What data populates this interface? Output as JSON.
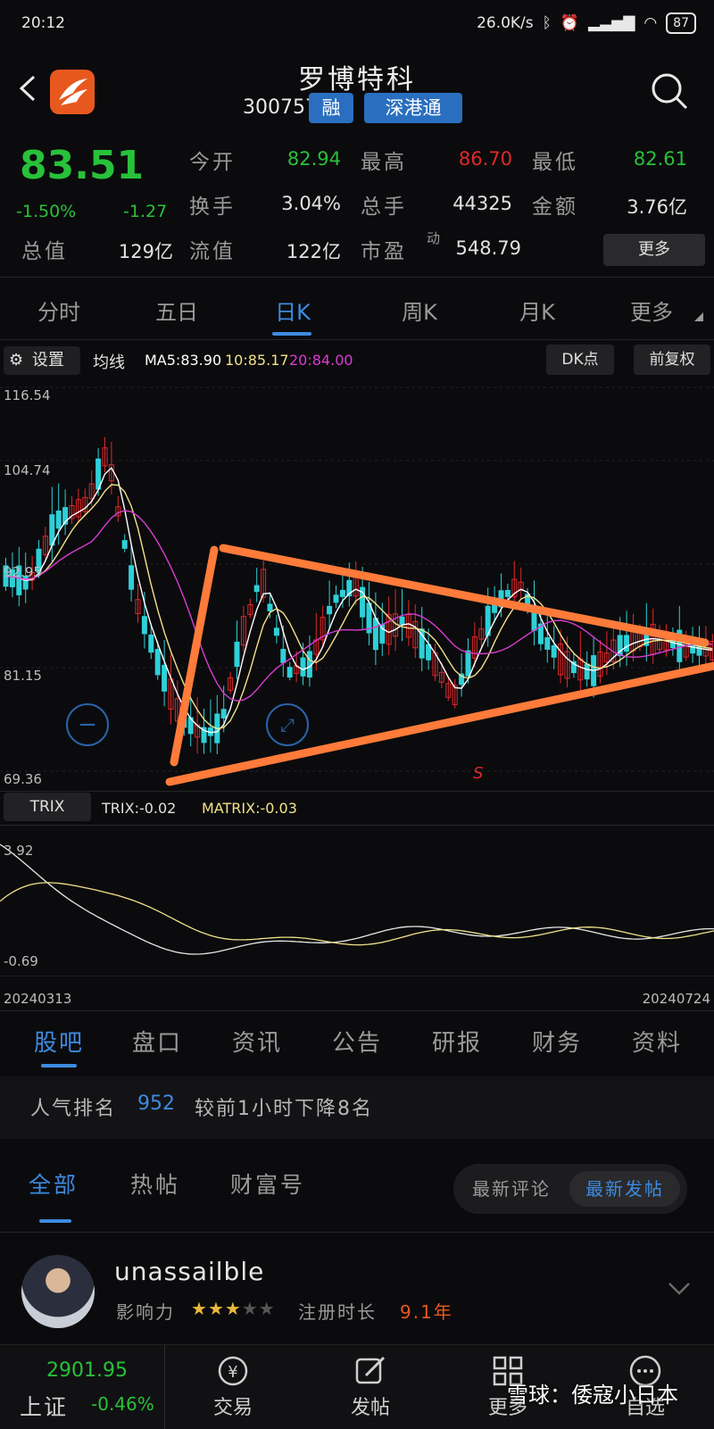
{
  "status": {
    "time": "20:12",
    "net_speed": "26.0K/s",
    "battery": "87"
  },
  "header": {
    "title": "罗博特科",
    "code": "300757",
    "tag_margin": "融",
    "tag_connect": "深港通"
  },
  "quote": {
    "price": "83.51",
    "change_pct": "-1.50%",
    "change": "-1.27",
    "items": [
      {
        "label": "今开",
        "value": "82.94",
        "color": "#28c13a"
      },
      {
        "label": "最高",
        "value": "86.70",
        "color": "#e0282a"
      },
      {
        "label": "最低",
        "value": "82.61",
        "color": "#28c13a"
      },
      {
        "label": "换手",
        "value": "3.04%",
        "color": "#e2e2e2"
      },
      {
        "label": "总手",
        "value": "44325",
        "color": "#e2e2e2"
      },
      {
        "label": "金额",
        "value": "3.76亿",
        "color": "#e2e2e2"
      },
      {
        "label": "总值",
        "value": "129亿",
        "color": "#e2e2e2"
      },
      {
        "label": "流值",
        "value": "122亿",
        "color": "#e2e2e2"
      },
      {
        "label": "市盈",
        "value": "548.79",
        "color": "#e2e2e2"
      }
    ],
    "pe_sup": "动",
    "more_label": "更多"
  },
  "period_tabs": [
    "分时",
    "五日",
    "日K",
    "周K",
    "月K",
    "更多"
  ],
  "kline": {
    "settings_label": "设置",
    "ma_label": "均线",
    "ma5": "MA5:83.90",
    "ma10": "10:85.17",
    "ma20": "20:84.00",
    "dk_label": "DK点",
    "adjust_label": "前复权",
    "y_labels": [
      "116.54",
      "104.74",
      "92.95",
      "81.15",
      "69.36"
    ],
    "annotation_s": "S",
    "colors": {
      "up": "#e0282a",
      "down": "#2ed0d8",
      "ma5": "#ffffff",
      "ma10": "#f2e28a",
      "ma20": "#d93cd3",
      "drawing": "#ff7b3a"
    }
  },
  "trix": {
    "label": "TRIX",
    "trix_value": "TRIX:-0.02",
    "matrix_value": "MATRIX:-0.03",
    "y_top": "3.92",
    "y_bottom": "-0.69",
    "date_start": "20240313",
    "date_end": "20240724"
  },
  "info_tabs": [
    "股吧",
    "盘口",
    "资讯",
    "公告",
    "研报",
    "财务",
    "资料"
  ],
  "rank": {
    "prefix": "人气排名",
    "number": "952",
    "suffix": "较前1小时下降8名"
  },
  "content_tabs": [
    "全部",
    "热帖",
    "财富号"
  ],
  "segment": [
    "最新评论",
    "最新发帖"
  ],
  "post": {
    "username": "unassailble",
    "influence_label": "影响力",
    "stars": 3,
    "reg_label": "注册时长",
    "reg_value": "9.1年"
  },
  "bottom_nav": {
    "index_value": "2901.95",
    "index_name": "上证",
    "index_change": "-0.46%",
    "items": [
      "交易",
      "发帖",
      "更多",
      "自选"
    ],
    "watermark": "雪球：倭寇小日本"
  }
}
